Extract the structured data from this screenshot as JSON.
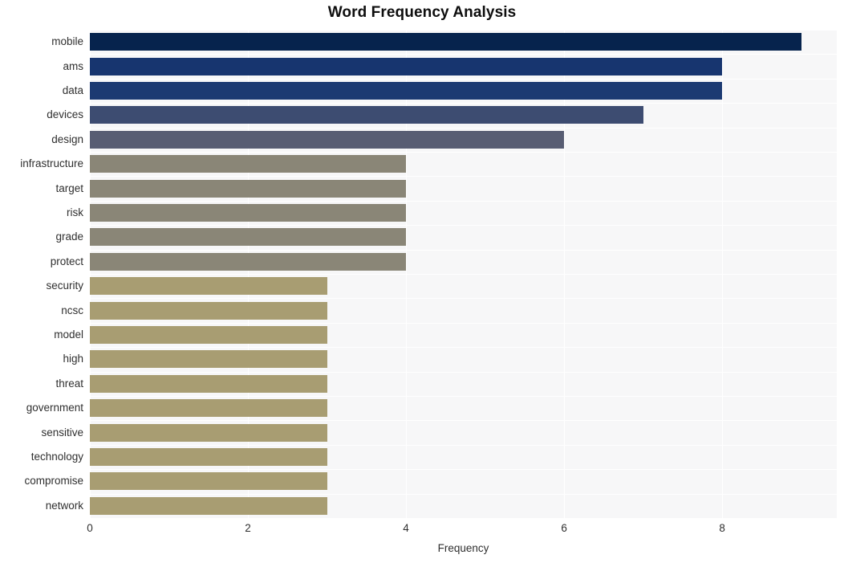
{
  "chart_data": {
    "type": "bar",
    "orientation": "horizontal",
    "title": "Word Frequency Analysis",
    "xlabel": "Frequency",
    "ylabel": "",
    "xlim": [
      0,
      9.45
    ],
    "xticks": [
      0,
      2,
      4,
      6,
      8
    ],
    "xtick_labels": [
      "0",
      "2",
      "4",
      "6",
      "8"
    ],
    "grid": true,
    "grid_color": "#ffffff",
    "plot_background": "#f7f7f8",
    "figure_background": "#ffffff",
    "legend": null,
    "categories": [
      "mobile",
      "ams",
      "data",
      "devices",
      "design",
      "infrastructure",
      "target",
      "risk",
      "grade",
      "protect",
      "security",
      "ncsc",
      "model",
      "high",
      "threat",
      "government",
      "sensitive",
      "technology",
      "compromise",
      "network"
    ],
    "values": [
      9,
      8,
      8,
      7,
      6,
      4,
      4,
      4,
      4,
      4,
      3,
      3,
      3,
      3,
      3,
      3,
      3,
      3,
      3,
      3
    ],
    "bar_colors": [
      "#06234d",
      "#17356f",
      "#1c3a72",
      "#3d4c71",
      "#585d73",
      "#8a8677",
      "#8a8677",
      "#8a8677",
      "#8a8677",
      "#8a8677",
      "#a89d72",
      "#a89d72",
      "#a89d72",
      "#a89d72",
      "#a89d72",
      "#a89d72",
      "#a89d72",
      "#a89d72",
      "#a89d72",
      "#a89d72"
    ]
  }
}
